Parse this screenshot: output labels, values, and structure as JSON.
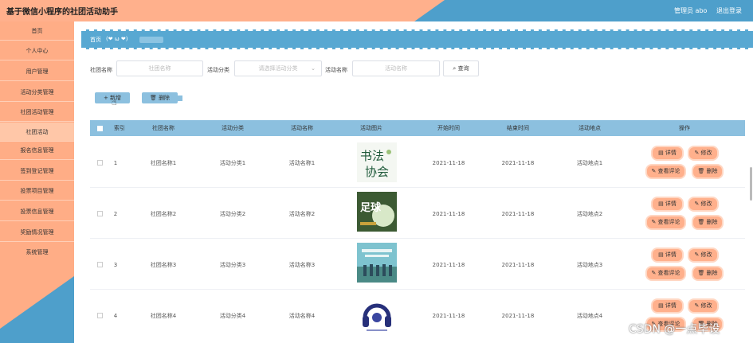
{
  "header": {
    "title": "基于微信小程序的社团活动助手",
    "user": "管理员 abo",
    "logout": "退出登录"
  },
  "sidebar": {
    "items": [
      {
        "label": "首页"
      },
      {
        "label": "个人中心"
      },
      {
        "label": "用户管理"
      },
      {
        "label": "活动分类管理"
      },
      {
        "label": "社团活动管理"
      },
      {
        "label": "社团活动"
      },
      {
        "label": "报名信息管理"
      },
      {
        "label": "签到登记管理"
      },
      {
        "label": "投票项目管理"
      },
      {
        "label": "投票信息管理"
      },
      {
        "label": "奖励情况管理"
      },
      {
        "label": "系统管理"
      }
    ]
  },
  "breadcrumb": {
    "home": "首页",
    "face": "(❤ ω ❤)"
  },
  "search": {
    "club_label": "社团名称",
    "club_placeholder": "社团名称",
    "category_label": "活动分类",
    "category_placeholder": "请选择活动分类",
    "activity_label": "活动名称",
    "activity_placeholder": "活动名称",
    "query_button": "查询"
  },
  "toolbar": {
    "add_label": "新增",
    "delete_label": "删除"
  },
  "table": {
    "headers": {
      "index": "索引",
      "club": "社团名称",
      "category": "活动分类",
      "activity": "活动名称",
      "image": "活动图片",
      "start": "开始时间",
      "end": "结束时间",
      "place": "活动地点",
      "ops": "操作"
    },
    "rows": [
      {
        "index": "1",
        "club": "社团名称1",
        "category": "活动分类1",
        "activity": "活动名称1",
        "start": "2021-11-18",
        "end": "2021-11-18",
        "place": "活动地点1"
      },
      {
        "index": "2",
        "club": "社团名称2",
        "category": "活动分类2",
        "activity": "活动名称2",
        "start": "2021-11-18",
        "end": "2021-11-18",
        "place": "活动地点2"
      },
      {
        "index": "3",
        "club": "社团名称3",
        "category": "活动分类3",
        "activity": "活动名称3",
        "start": "2021-11-18",
        "end": "2021-11-18",
        "place": "活动地点3"
      },
      {
        "index": "4",
        "club": "社团名称4",
        "category": "活动分类4",
        "activity": "活动名称4",
        "start": "2021-11-18",
        "end": "2021-11-18",
        "place": "活动地点4"
      }
    ],
    "actions": {
      "detail": "详情",
      "edit": "修改",
      "review": "查看评论",
      "delete": "删除"
    }
  },
  "watermark": "CSDN @一点毕设",
  "colors": {
    "header_orange": "#ffb08c",
    "header_blue": "#4e9fcb",
    "table_header": "#8cc0df",
    "action_button": "#ffb08c"
  }
}
